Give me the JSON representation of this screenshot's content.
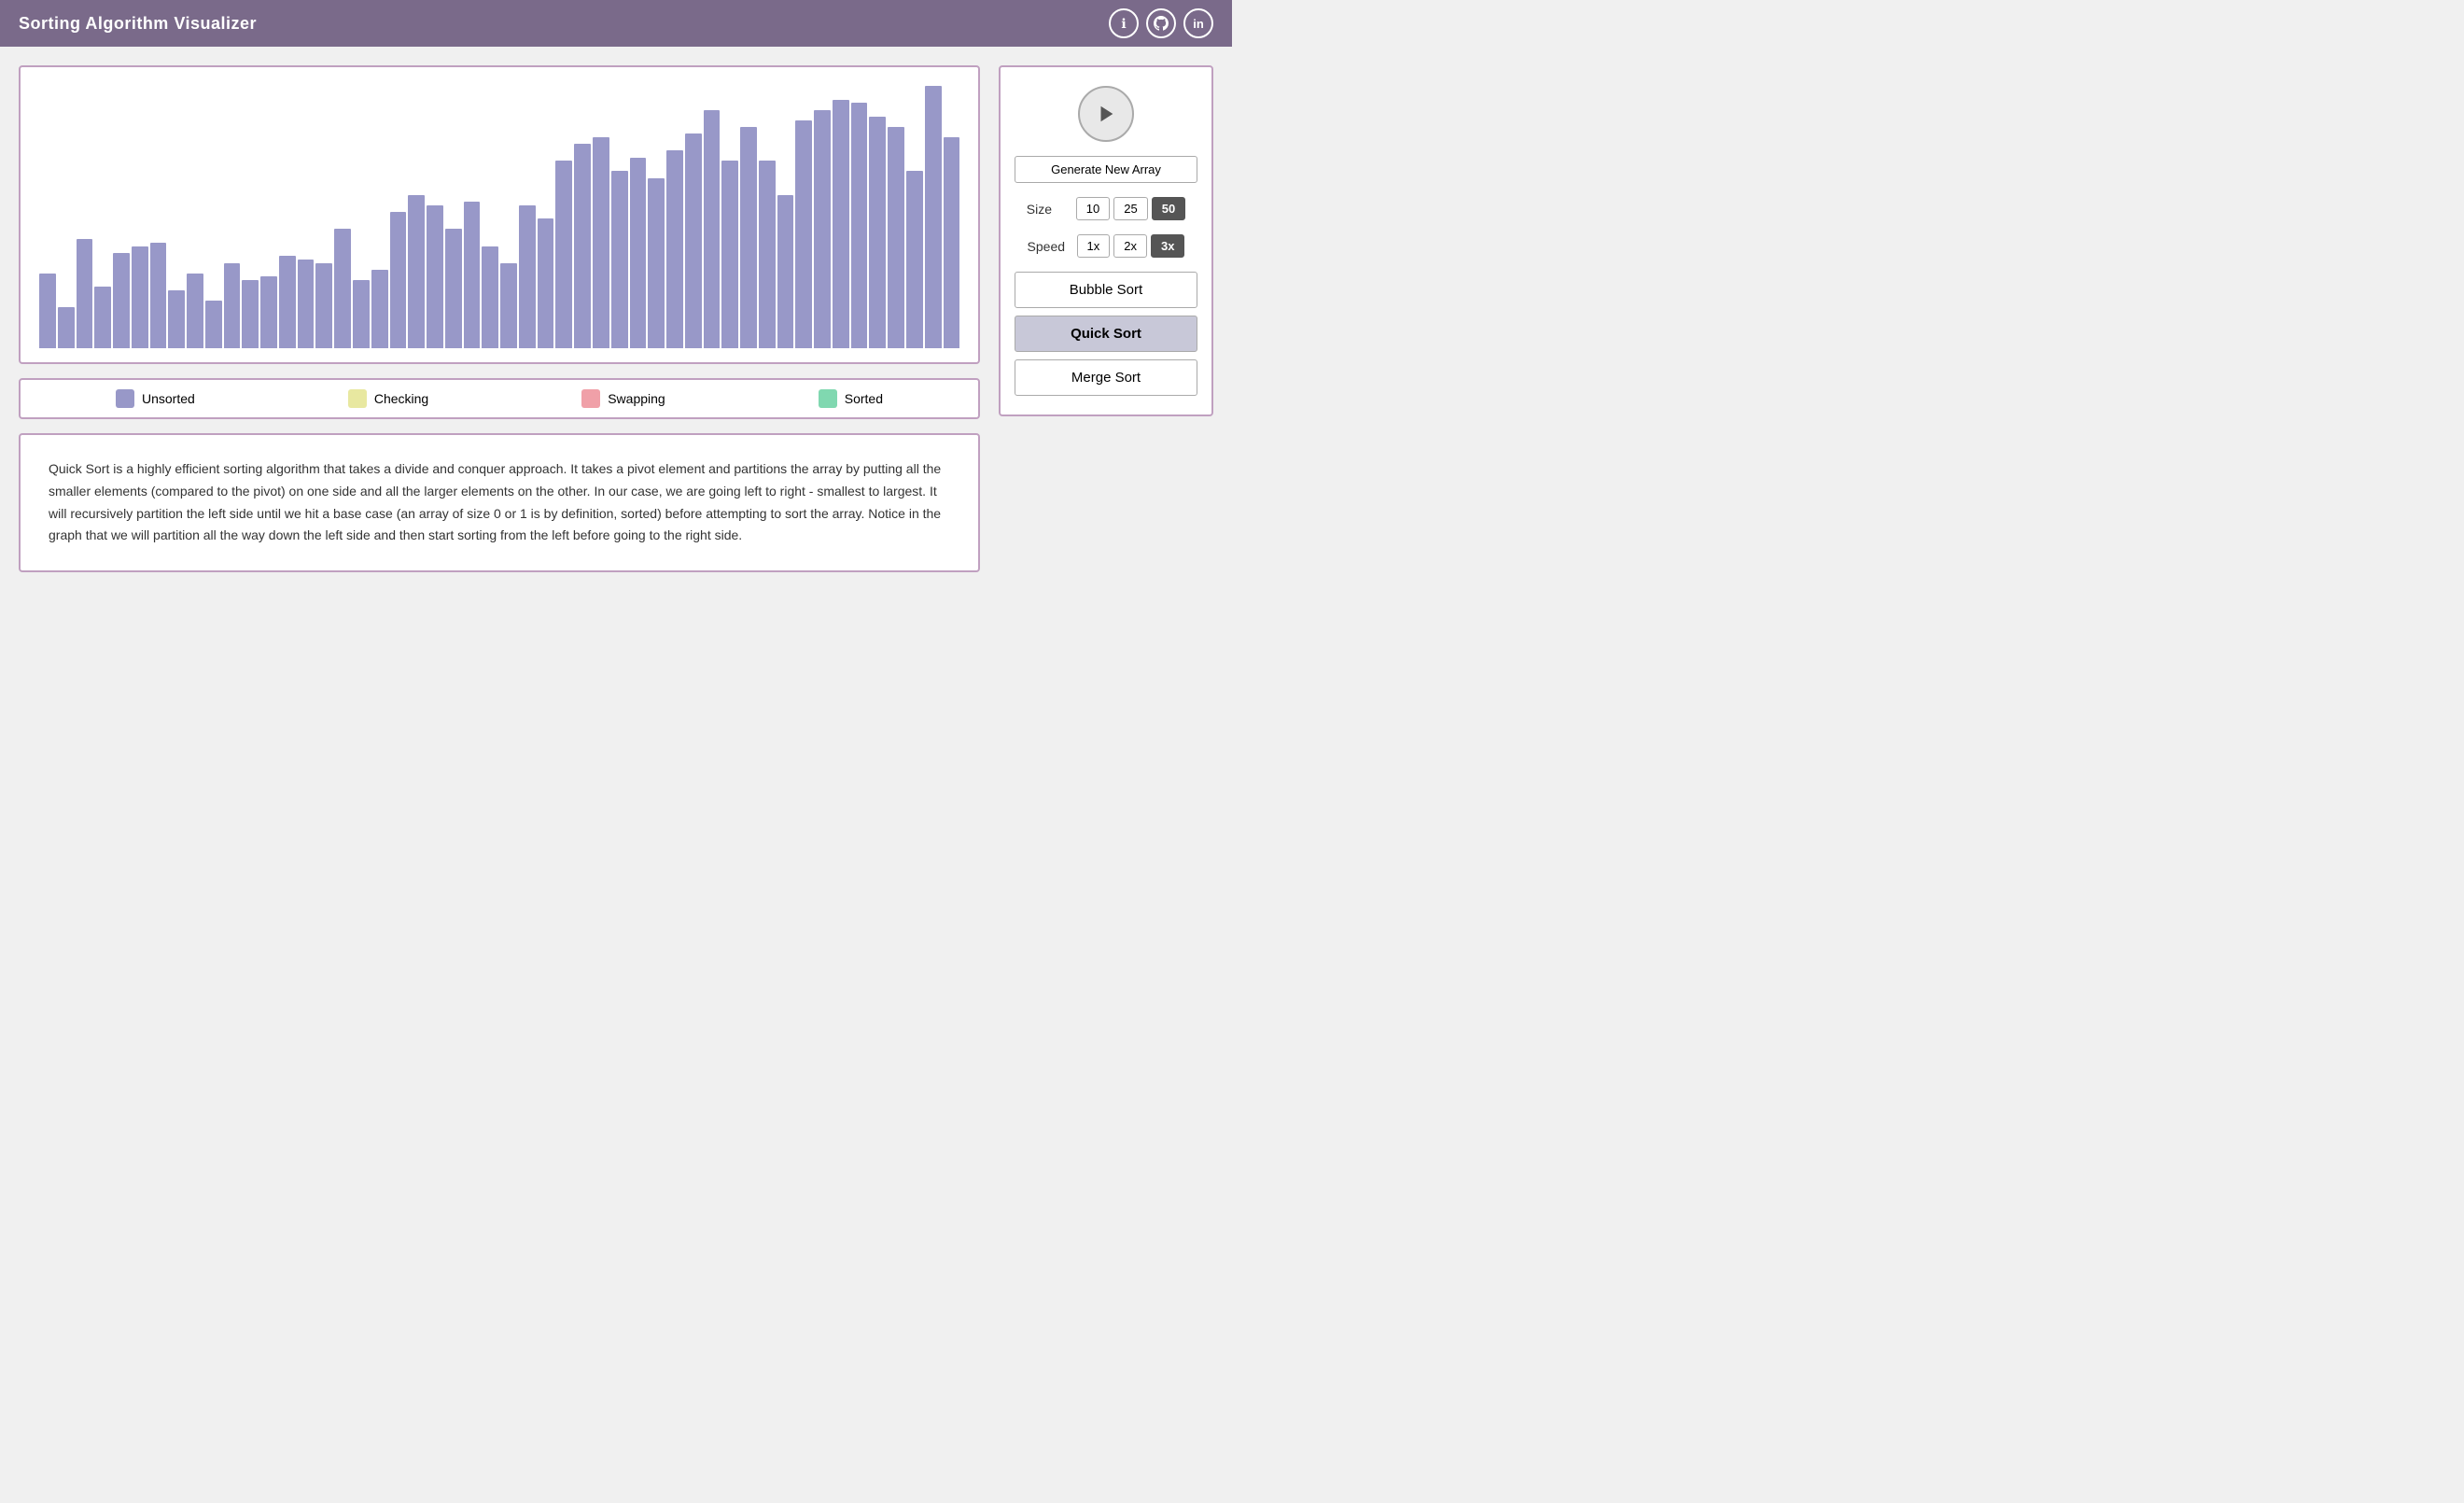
{
  "header": {
    "title": "Sorting Algorithm Visualizer",
    "icons": [
      {
        "name": "info-icon",
        "symbol": "ℹ"
      },
      {
        "name": "github-icon",
        "symbol": "⌥"
      },
      {
        "name": "linkedin-icon",
        "symbol": "in"
      }
    ]
  },
  "controls": {
    "play_label": "▶",
    "generate_label": "Generate New Array",
    "size_label": "Size",
    "size_options": [
      "10",
      "25",
      "50"
    ],
    "size_active": "50",
    "speed_label": "Speed",
    "speed_options": [
      "1x",
      "2x",
      "3x"
    ],
    "speed_active": "3x"
  },
  "algorithms": [
    {
      "label": "Bubble Sort",
      "active": false
    },
    {
      "label": "Quick Sort",
      "active": true
    },
    {
      "label": "Merge Sort",
      "active": false
    }
  ],
  "legend": [
    {
      "label": "Unsorted",
      "color": "#9898c8"
    },
    {
      "label": "Checking",
      "color": "#e8e8a0"
    },
    {
      "label": "Swapping",
      "color": "#f0a0a8"
    },
    {
      "label": "Sorted",
      "color": "#80d8b0"
    }
  ],
  "description": {
    "text": "Quick Sort is a highly efficient sorting algorithm that takes a divide and conquer approach. It takes a pivot element and partitions the array by putting all the smaller elements (compared to the pivot) on one side and all the larger elements on the other. In our case, we are going left to right - smallest to largest. It will recursively partition the left side until we hit a base case (an array of size 0 or 1 is by definition, sorted) before attempting to sort the array. Notice in the graph that we will partition all the way down the left side and then start sorting from the left before going to the right side."
  },
  "bars": [
    22,
    12,
    32,
    18,
    28,
    30,
    31,
    17,
    22,
    14,
    25,
    20,
    21,
    27,
    26,
    25,
    35,
    20,
    23,
    40,
    45,
    42,
    35,
    43,
    30,
    25,
    42,
    38,
    55,
    60,
    62,
    52,
    56,
    50,
    58,
    63,
    70,
    55,
    65,
    55,
    45,
    67,
    70,
    73,
    72,
    68,
    65,
    52,
    77,
    62
  ]
}
